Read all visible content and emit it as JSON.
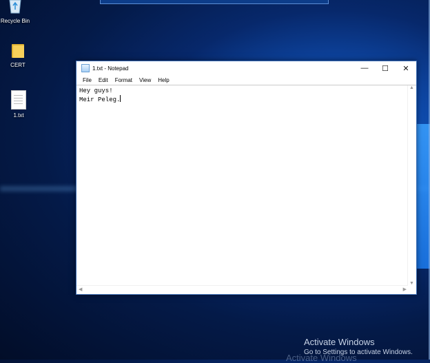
{
  "desktop": {
    "icons": [
      {
        "label": "Recycle Bin",
        "icon": "recycle-bin-icon"
      },
      {
        "label": "CERT",
        "icon": "folder-icon"
      },
      {
        "label": "1.txt",
        "icon": "text-file-icon"
      }
    ]
  },
  "notepad": {
    "title": "1.txt - Notepad",
    "menu": [
      "File",
      "Edit",
      "Format",
      "View",
      "Help"
    ],
    "controls": {
      "minimize": "—",
      "maximize": "☐",
      "close": "✕"
    },
    "lines": [
      "Hey guys!",
      "Meir Peleg."
    ]
  },
  "watermark": {
    "heading": "Activate Windows",
    "subtext": "Go to Settings to activate Windows.",
    "ghost": "Activate Windows"
  }
}
